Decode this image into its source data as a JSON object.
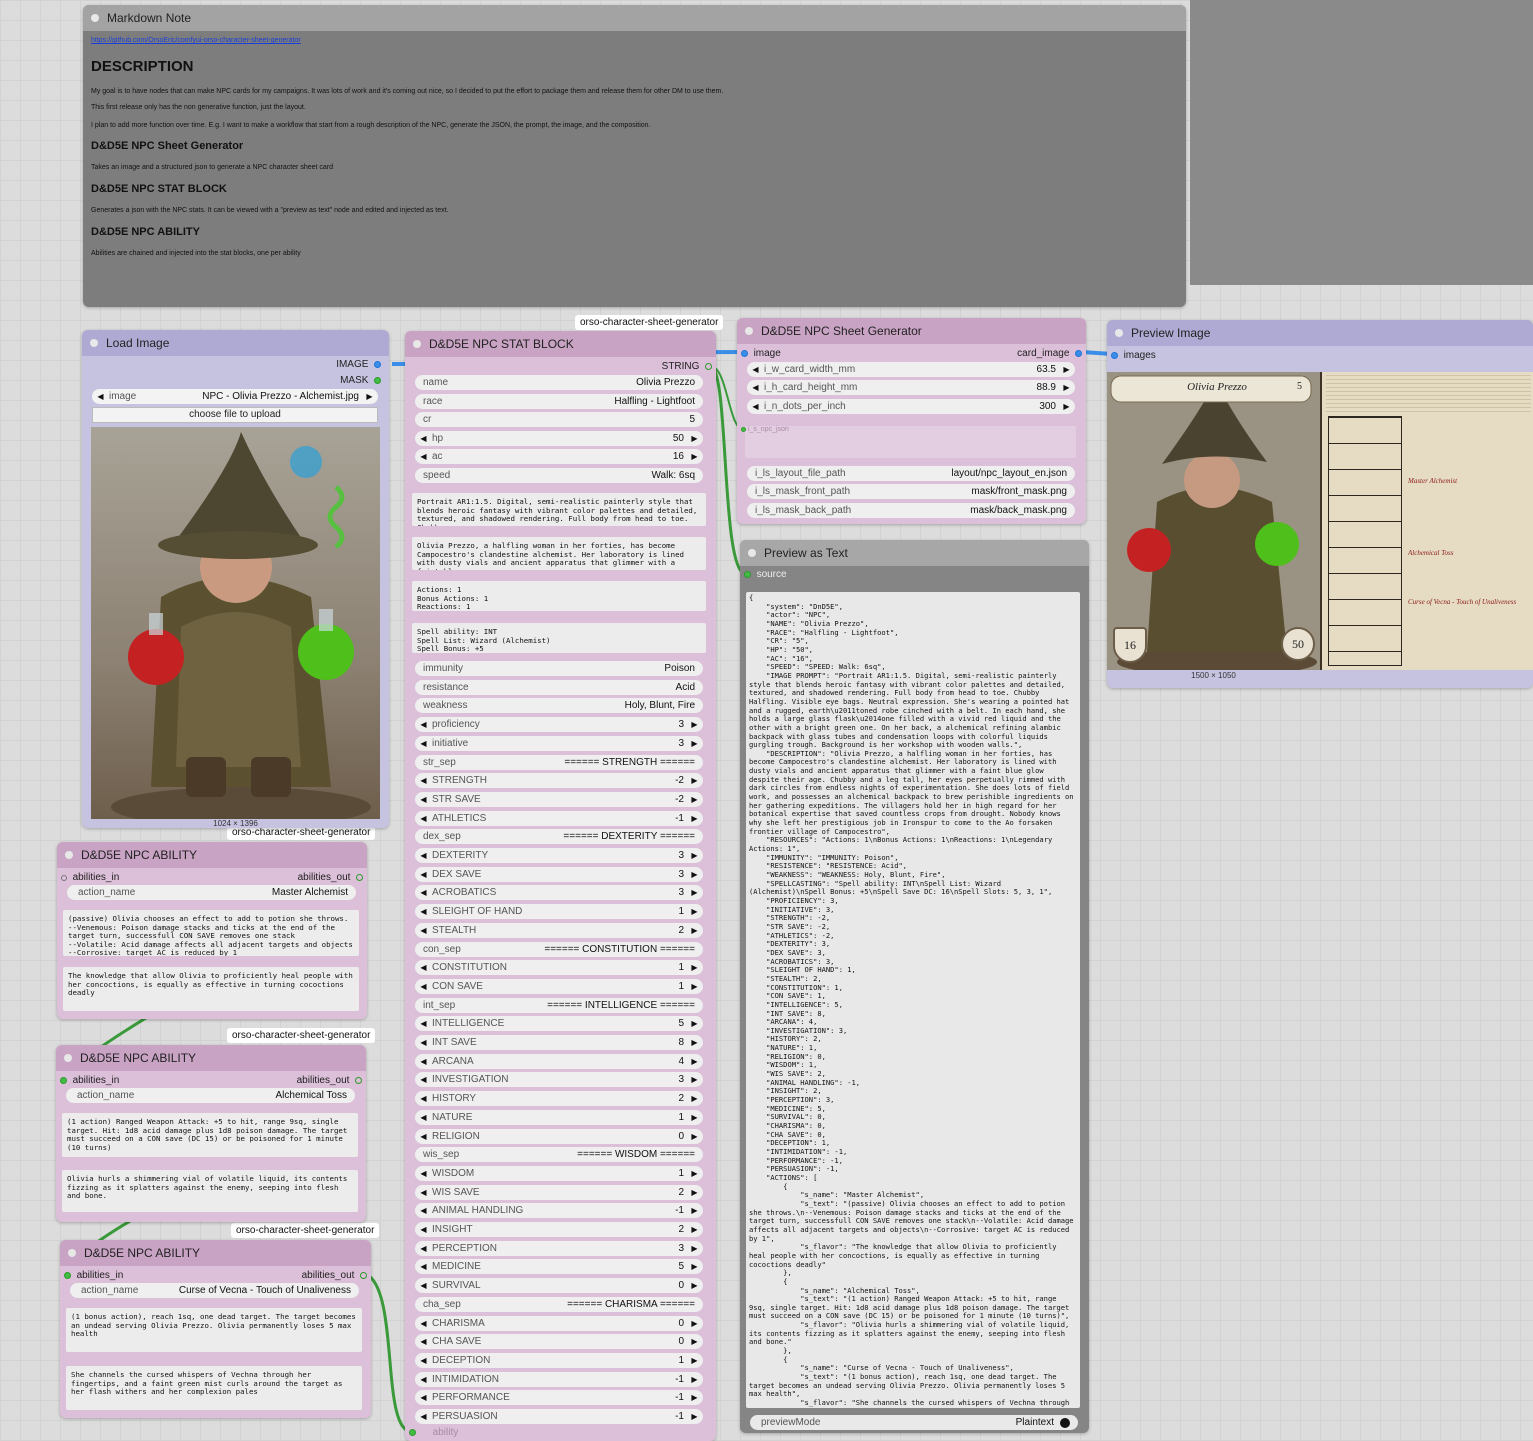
{
  "markdown_note": {
    "title": "Markdown Note",
    "link": "https://github.com/OrsoEric/comfyui-orso-character-sheet-generator",
    "h_description": "DESCRIPTION",
    "p1": "My goal is to have nodes that can make NPC cards for my campaigns. It was lots of work and it's coming out nice, so I decided to put the effort to package them and release them for other DM to use them.",
    "p2": "This first release only has the non generative function, just the layout.",
    "p3": "I plan to add more function over time. E.g. I want to make a workflow that start from a rough description of the NPC, generate the JSON, the prompt, the image, and the composition.",
    "h_sheet": "D&D5E NPC Sheet Generator",
    "p_sheet": "Takes an image and a structured json to generate a NPC character sheet card",
    "h_stat": "D&D5E NPC STAT BLOCK",
    "p_stat": "Generates a json with the NPC stats. It can be viewed with a \"preview as text\" node and edited and injected as text.",
    "h_ability": "D&D5E NPC ABILITY",
    "p_ability": "Abilities are chained and injected into the stat blocks, one per ability"
  },
  "group_tag": "orso-character-sheet-generator",
  "load_image": {
    "title": "Load Image",
    "out_image": "IMAGE",
    "out_mask": "MASK",
    "image_label": "image",
    "image_value": "NPC - Olivia Prezzo - Alchemist.jpg",
    "upload_label": "choose file to upload",
    "dims": "1024 × 1396"
  },
  "stat_block": {
    "title": "D&D5E NPC STAT BLOCK",
    "out_string": "STRING",
    "fields": [
      {
        "label": "name",
        "value": "Olivia Prezzo",
        "arrows": false
      },
      {
        "label": "race",
        "value": "Halfling - Lightfoot",
        "arrows": false
      },
      {
        "label": "cr",
        "value": "5",
        "arrows": false
      },
      {
        "label": "hp",
        "value": "50",
        "arrows": true
      },
      {
        "label": "ac",
        "value": "16",
        "arrows": true
      },
      {
        "label": "speed",
        "value": "Walk: 6sq",
        "arrows": false
      }
    ],
    "text_prompt": "Portrait AR1:1.5. Digital, semi-realistic painterly style that blends heroic fantasy with vibrant color palettes and detailed, textured, and shadowed rendering. Full body from head to toe. Chubby",
    "text_description": "Olivia Prezzo, a halfling woman in her forties, has become Campocestro's clandestine alchemist. Her laboratory is lined with dusty vials and ancient apparatus that glimmer with a faint blue",
    "text_resources": "Actions: 1\nBonus Actions: 1\nReactions: 1",
    "text_spell": "Spell ability: INT\nSpell List: Wizard (Alchemist)\nSpell Bonus: +5",
    "stats": [
      {
        "label": "immunity",
        "value": "Poison",
        "arrows": false
      },
      {
        "label": "resistance",
        "value": "Acid",
        "arrows": false
      },
      {
        "label": "weakness",
        "value": "Holy, Blunt, Fire",
        "arrows": false
      },
      {
        "label": "proficiency",
        "value": "3",
        "arrows": true
      },
      {
        "label": "initiative",
        "value": "3",
        "arrows": true
      },
      {
        "label": "str_sep",
        "value": "====== STRENGTH ======",
        "arrows": false
      },
      {
        "label": "STRENGTH",
        "value": "-2",
        "arrows": true
      },
      {
        "label": "STR SAVE",
        "value": "-2",
        "arrows": true
      },
      {
        "label": "ATHLETICS",
        "value": "-1",
        "arrows": true
      },
      {
        "label": "dex_sep",
        "value": "====== DEXTERITY ======",
        "arrows": false
      },
      {
        "label": "DEXTERITY",
        "value": "3",
        "arrows": true
      },
      {
        "label": "DEX SAVE",
        "value": "3",
        "arrows": true
      },
      {
        "label": "ACROBATICS",
        "value": "3",
        "arrows": true
      },
      {
        "label": "SLEIGHT OF HAND",
        "value": "1",
        "arrows": true
      },
      {
        "label": "STEALTH",
        "value": "2",
        "arrows": true
      },
      {
        "label": "con_sep",
        "value": "====== CONSTITUTION ======",
        "arrows": false
      },
      {
        "label": "CONSTITUTION",
        "value": "1",
        "arrows": true
      },
      {
        "label": "CON SAVE",
        "value": "1",
        "arrows": true
      },
      {
        "label": "int_sep",
        "value": "====== INTELLIGENCE ======",
        "arrows": false
      },
      {
        "label": "INTELLIGENCE",
        "value": "5",
        "arrows": true
      },
      {
        "label": "INT SAVE",
        "value": "8",
        "arrows": true
      },
      {
        "label": "ARCANA",
        "value": "4",
        "arrows": true
      },
      {
        "label": "INVESTIGATION",
        "value": "3",
        "arrows": true
      },
      {
        "label": "HISTORY",
        "value": "2",
        "arrows": true
      },
      {
        "label": "NATURE",
        "value": "1",
        "arrows": true
      },
      {
        "label": "RELIGION",
        "value": "0",
        "arrows": true
      },
      {
        "label": "wis_sep",
        "value": "====== WISDOM ======",
        "arrows": false
      },
      {
        "label": "WISDOM",
        "value": "1",
        "arrows": true
      },
      {
        "label": "WIS SAVE",
        "value": "2",
        "arrows": true
      },
      {
        "label": "ANIMAL HANDLING",
        "value": "-1",
        "arrows": true
      },
      {
        "label": "INSIGHT",
        "value": "2",
        "arrows": true
      },
      {
        "label": "PERCEPTION",
        "value": "3",
        "arrows": true
      },
      {
        "label": "MEDICINE",
        "value": "5",
        "arrows": true
      },
      {
        "label": "SURVIVAL",
        "value": "0",
        "arrows": true
      },
      {
        "label": "cha_sep",
        "value": "====== CHARISMA ======",
        "arrows": false
      },
      {
        "label": "CHARISMA",
        "value": "0",
        "arrows": true
      },
      {
        "label": "CHA SAVE",
        "value": "0",
        "arrows": true
      },
      {
        "label": "DECEPTION",
        "value": "1",
        "arrows": true
      },
      {
        "label": "INTIMIDATION",
        "value": "-1",
        "arrows": true
      },
      {
        "label": "PERFORMANCE",
        "value": "-1",
        "arrows": true
      },
      {
        "label": "PERSUASION",
        "value": "-1",
        "arrows": true
      }
    ],
    "ability_input": "ability"
  },
  "sheet_gen": {
    "title": "D&D5E NPC Sheet Generator",
    "in_image": "image",
    "out_card": "card_image",
    "fields": [
      {
        "label": "i_w_card_width_mm",
        "value": "63.5",
        "arrows": true
      },
      {
        "label": "i_h_card_height_mm",
        "value": "88.9",
        "arrows": true
      },
      {
        "label": "i_n_dots_per_inch",
        "value": "300",
        "arrows": true
      }
    ],
    "json_input": "i_s_npc_json",
    "paths": [
      {
        "label": "i_ls_layout_file_path",
        "value": "layout/npc_layout_en.json"
      },
      {
        "label": "i_ls_mask_front_path",
        "value": "mask/front_mask.png"
      },
      {
        "label": "i_ls_mask_back_path",
        "value": "mask/back_mask.png"
      }
    ]
  },
  "preview_image": {
    "title": "Preview Image",
    "in_images": "images",
    "dims": "1500 × 1050",
    "card": {
      "name": "Olivia Prezzo",
      "cr": "5",
      "ac": "16",
      "hp": "50",
      "back_headings": [
        "Master Alchemist",
        "Alchemical Toss",
        "Curse of Vecna - Touch of Unaliveness"
      ]
    }
  },
  "preview_text": {
    "title": "Preview as Text",
    "in_source": "source",
    "content": "{\n    \"system\": \"DnD5E\",\n    \"actor\": \"NPC\",\n    \"NAME\": \"Olivia Prezzo\",\n    \"RACE\": \"Halfling - Lightfoot\",\n    \"CR\": \"5\",\n    \"HP\": \"50\",\n    \"AC\": \"16\",\n    \"SPEED\": \"SPEED: Walk: 6sq\",\n    \"IMAGE PROMPT\": \"Portrait AR1:1.5. Digital, semi-realistic painterly style that blends heroic fantasy with vibrant color palettes and detailed, textured, and shadowed rendering. Full body from head to toe. Chubby Halfling. Visible eye bags. Neutral expression. She's wearing a pointed hat and a rugged, earth\\u2011toned robe cinched with a belt. In each hand, she holds a large glass flask\\u2014one filled with a vivid red liquid and the other with a bright green one. On her back, a alchemical refining alambic backpack with glass tubes and condensation loops with colorful liquids gurgling trough. Background is her workshop with wooden walls.\",\n    \"DESCRIPTION\": \"Olivia Prezzo, a halfling woman in her forties, has become Campocestro's clandestine alchemist. Her laboratory is lined with dusty vials and ancient apparatus that glimmer with a faint blue glow despite their age. Chubby and a leg tall, her eyes perpetually rimmed with dark circles from endless nights of experimentation. She does lots of field work, and possesses an alchemical backpack to brew perishible ingredients on her gathering expeditions. The villagers hold her in high regard for her botanical expertise that saved countless crops from drought. Nobody knows why she left her prestigious job in Ironspur to come to the Ao forsaken frontier village of Campocestro\",\n    \"RESOURCES\": \"Actions: 1\\nBonus Actions: 1\\nReactions: 1\\nLegendary Actions: 1\",\n    \"IMMUNITY\": \"IMMUNITY: Poison\",\n    \"RESISTENCE\": \"RESISTENCE: Acid\",\n    \"WEAKNESS\": \"WEAKNESS: Holy, Blunt, Fire\",\n    \"SPELLCASTING\": \"Spell ability: INT\\nSpell List: Wizard (Alchemist)\\nSpell Bonus: +5\\nSpell Save DC: 16\\nSpell Slots: 5, 3, 1\",\n    \"PROFICIENCY\": 3,\n    \"INITIATIVE\": 3,\n    \"STRENGTH\": -2,\n    \"STR SAVE\": -2,\n    \"ATHLETICS\": -2,\n    \"DEXTERITY\": 3,\n    \"DEX SAVE\": 3,\n    \"ACROBATICS\": 3,\n    \"SLEIGHT OF HAND\": 1,\n    \"STEALTH\": 2,\n    \"CONSTITUTION\": 1,\n    \"CON SAVE\": 1,\n    \"INTELLIGENCE\": 5,\n    \"INT SAVE\": 8,\n    \"ARCANA\": 4,\n    \"INVESTIGATION\": 3,\n    \"HISTORY\": 2,\n    \"NATURE\": 1,\n    \"RELIGION\": 0,\n    \"WISDOM\": 1,\n    \"WIS SAVE\": 2,\n    \"ANIMAL HANDLING\": -1,\n    \"INSIGHT\": 2,\n    \"PERCEPTION\": 3,\n    \"MEDICINE\": 5,\n    \"SURVIVAL\": 0,\n    \"CHARISMA\": 0,\n    \"CHA SAVE\": 0,\n    \"DECEPTION\": 1,\n    \"INTIMIDATION\": -1,\n    \"PERFORMANCE\": -1,\n    \"PERSUASION\": -1,\n    \"ACTIONS\": [\n        {\n            \"s_name\": \"Master Alchemist\",\n            \"s_text\": \"(passive) Olivia chooses an effect to add to potion she throws.\\n--Venemous: Poison damage stacks and ticks at the end of the target turn, successfull CON SAVE removes one stack\\n--Volatile: Acid damage affects all adjacent targets and objects\\n--Corrosive: target AC is reduced by 1\",\n            \"s_flavor\": \"The knowledge that allow Olivia to proficiently heal people with her concoctions, is equally as effective in turning cococtions deadly\"\n        },\n        {\n            \"s_name\": \"Alchemical Toss\",\n            \"s_text\": \"(1 action) Ranged Weapon Attack: +5 to hit, range 9sq, single target. Hit: 1d8 acid damage plus 1d8 poison damage. The target must succeed on a CON save (DC 15) or be poisoned for 1 minute (10 turns)\",\n            \"s_flavor\": \"Olivia hurls a shimmering vial of volatile liquid, its contents fizzing as it splatters against the enemy, seeping into flesh and bone.\"\n        },\n        {\n            \"s_name\": \"Curse of Vecna - Touch of Unaliveness\",\n            \"s_text\": \"(1 bonus action), reach 1sq, one dead target. The target becomes an undead serving Olivia Prezzo. Olivia permanently loses 5 max health\",\n            \"s_flavor\": \"She channels the cursed whispers of Vechna through",
    "mode_label": "previewMode",
    "mode_value": "Plaintext"
  },
  "abilities": [
    {
      "title": "D&D5E NPC ABILITY",
      "in_label": "abilities_in",
      "out_label": "abilities_out",
      "name_label": "action_name",
      "name_value": "Master Alchemist",
      "text": "(passive) Olivia chooses an effect to add to potion she throws.\n--Venemous: Poison damage stacks and ticks at the end of the target turn, successfull CON SAVE removes one stack\n--Volatile: Acid damage affects all adjacent targets and objects\n--Corrosive: target AC is reduced by 1",
      "flavor": "The knowledge that allow Olivia to proficiently heal people with her concoctions, is equally as effective in turning cococtions deadly"
    },
    {
      "title": "D&D5E NPC ABILITY",
      "in_label": "abilities_in",
      "out_label": "abilities_out",
      "name_label": "action_name",
      "name_value": "Alchemical Toss",
      "text": "(1 action) Ranged Weapon Attack: +5 to hit, range 9sq, single target. Hit: 1d8 acid damage plus 1d8 poison damage. The target must succeed on a CON save (DC 15) or be poisoned for 1 minute (10 turns)",
      "flavor": "Olivia hurls a shimmering vial of volatile liquid, its contents fizzing as it splatters against the enemy, seeping into flesh and bone."
    },
    {
      "title": "D&D5E NPC ABILITY",
      "in_label": "abilities_in",
      "out_label": "abilities_out",
      "name_label": "action_name",
      "name_value": "Curse of Vecna - Touch of Unaliveness",
      "text": "(1 bonus action), reach 1sq, one dead target. The target becomes an undead serving Olivia Prezzo. Olivia permanently loses 5 max health",
      "flavor": "She channels the cursed whispers of Vechna through her fingertips, and a faint green mist curls around the target as her flash withers and her complexion pales"
    }
  ],
  "colors": {
    "pink_node": "#dcbfd8",
    "lavender_node": "#c6c3e0",
    "link_green": "#3a9a3a",
    "link_blue": "#3a8ee8"
  }
}
